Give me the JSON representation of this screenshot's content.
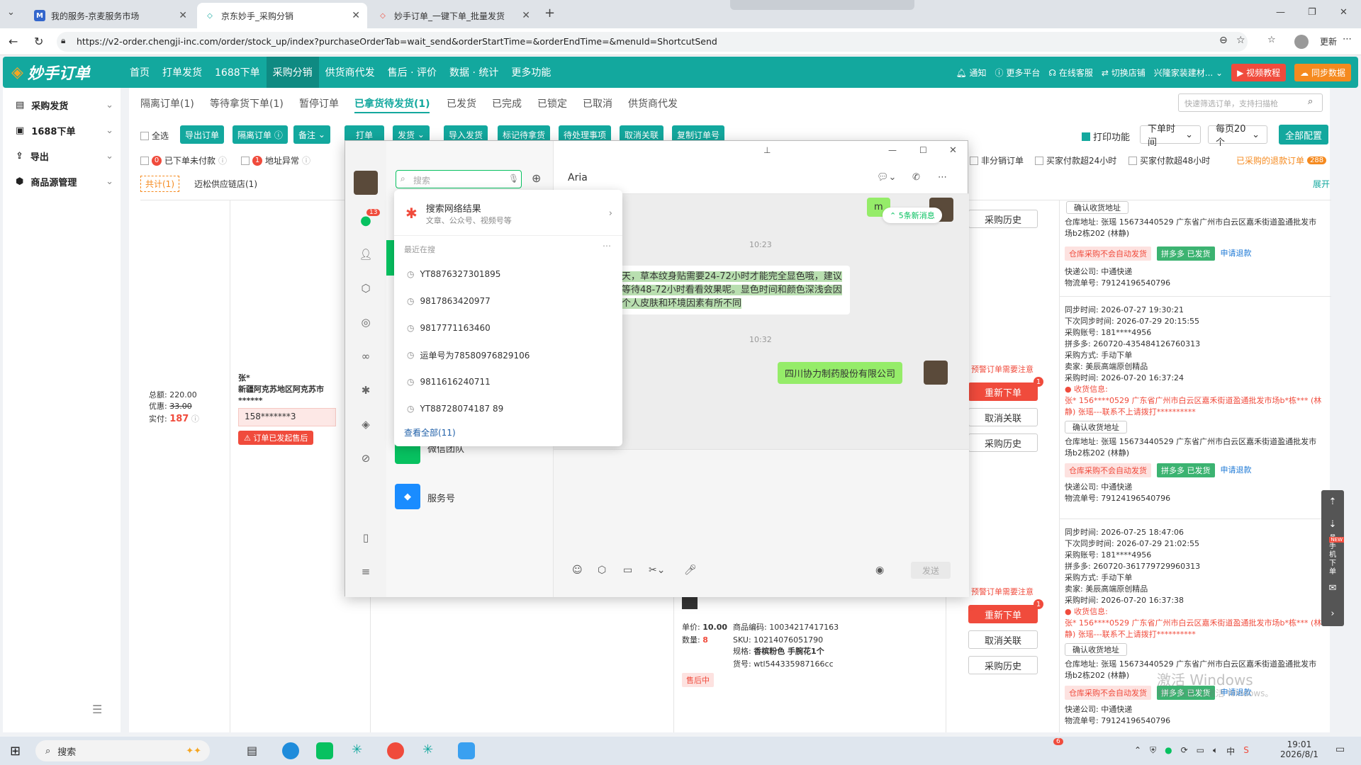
{
  "browser": {
    "tabs": [
      {
        "title": "我的服务-京麦服务市场",
        "icon": "M"
      },
      {
        "title": "京东妙手_采购分销",
        "icon": "◇"
      },
      {
        "title": "妙手订单_一键下单_批量发货",
        "icon": "◇"
      }
    ],
    "new_tab": "+",
    "url": "https://v2-order.chengji-inc.com/order/stock_up/index?purchaseOrderTab=wait_send&orderStartTime=&orderEndTime=&menuId=ShortcutSend",
    "update_label": "更新"
  },
  "app": {
    "logo": "妙手订单",
    "nav": [
      "首页",
      "打单发货",
      "1688下单",
      "采购分销",
      "供货商代发",
      "售后 · 评价",
      "数据 · 统计",
      "更多功能"
    ],
    "right_nav": [
      "通知",
      "更多平台",
      "在线客服",
      "切换店铺",
      "兴隆家装建材..."
    ],
    "video_btn": "视频教程",
    "sync_btn": "同步数据"
  },
  "sidebar": [
    {
      "label": "采购发货",
      "icon": "▤"
    },
    {
      "label": "1688下单",
      "icon": "▣"
    },
    {
      "label": "导出",
      "icon": "⇪"
    },
    {
      "label": "商品源管理",
      "icon": "⬢"
    }
  ],
  "subtabs": [
    "隔离订单(1)",
    "等待拿货下单(1)",
    "暂停订单",
    "已拿货待发货(1)",
    "已发货",
    "已完成",
    "已锁定",
    "已取消",
    "供货商代发"
  ],
  "search_placeholder": "快速筛选订单，支持扫描枪",
  "toolbar": {
    "select_all": "全选",
    "buttons": [
      "导出订单",
      "隔离订单 ⓘ",
      "备注",
      "打单",
      "发货",
      "导入发货",
      "标记待拿货",
      "待处理事项",
      "取消关联",
      "复制订单号"
    ],
    "print_func": "打印功能",
    "order_time": "下单时间",
    "per_page": "每页20个",
    "all_config": "全部配置"
  },
  "filters": {
    "unpaid": "已下单未付款",
    "unpaid_count": "0",
    "addr_abnormal": "地址异常",
    "addr_count": "1",
    "nondist": "非分销订单",
    "pay24": "买家付款超24小时",
    "pay48": "买家付款超48小时",
    "refund": "已采购的退款订单",
    "refund_count": "288"
  },
  "store": {
    "total": "共计(1)",
    "name": "迈松供应链店(1)",
    "expand": "展开"
  },
  "order": {
    "amount_label": "总额:",
    "amount": "220.00",
    "discount_label": "优惠:",
    "discount": "33.00",
    "paid_label": "实付:",
    "paid": "187",
    "buyer": "张*",
    "region": "新疆阿克苏地区阿克苏市",
    "masked": "******",
    "phone": "158*******3",
    "aftersale": "订单已发起售后",
    "price_label": "单价:",
    "price": "10.00",
    "qty_label": "数量:",
    "qty": "8",
    "code": "商品编码: 10034217417163",
    "sku": "SKU: 10214076051790",
    "spec_label": "规格:",
    "spec": "香槟粉色 手腕花1个",
    "goods_no": "货号: wtl544335987166cc",
    "status": "售后中"
  },
  "actions": {
    "history": "采购历史",
    "reorder": "重新下单",
    "cancel": "取消关联",
    "warn": "预警订单需要注意",
    "badge": "1"
  },
  "details": [
    {
      "sync": "同步时间: 2026-07-27 19:30:21",
      "next": "下次同步时间: 2026-07-29 20:15:55",
      "acct": "采购账号: 181****4956",
      "pdd": "拼多多: 260720-435484126760313",
      "method": "采购方式: 手动下单",
      "seller": "卖家: 美辰高端原创精品",
      "ptime": "采购时间: 2026-07-20 16:37:24"
    },
    {
      "sync": "同步时间: 2026-07-25 18:47:06",
      "next": "下次同步时间: 2026-07-29 21:02:55",
      "acct": "采购账号: 181****4956",
      "pdd": "拼多多: 260720-361779729960313",
      "method": "采购方式: 手动下单",
      "seller": "卖家: 美辰高端原创精品",
      "ptime": "采购时间: 2026-07-20 16:37:38"
    }
  ],
  "detail_common": {
    "confirm": "确认收货地址",
    "addr": "仓库地址: 张瑶 15673440529 广东省广州市白云区嘉禾街道盈通批发市场b2栋202 (林静)",
    "no_auto": "仓库采购不会自动发货",
    "pdd_sent": "拼多多 已发货",
    "refund": "申请退款",
    "courier": "快递公司: 中通快递",
    "tracking": "物流单号: 79124196540796",
    "recv": "收货信息:",
    "recv_addr": "张* 156****0529 广东省广州市白云区嘉禾街道盈通批发市场b*栋*** (林静) 张瑶---联系不上请拨打**********"
  },
  "chat": {
    "contact": "Aria",
    "search_placeholder": "搜索",
    "unread": "13",
    "new_msgs": "5条新消息",
    "time1": "10:23",
    "time2": "10:32",
    "msg_in": "天，草本纹身贴需要24-72小时才能完全显色哦，建议等待48-72小时看看效果呢。显色时间和颜色深浅会因个人皮肤和环境因素有所不同",
    "msg_out": "四川协力制药股份有限公司",
    "msg_top": "m",
    "send": "发送",
    "service": "服务号",
    "partial": "微信团队"
  },
  "dropdown": {
    "web_title": "搜索网络结果",
    "web_sub": "文章、公众号、视频号等",
    "recent": "最近在搜",
    "items": [
      "YT8876327301895",
      "9817863420977",
      "9817771163460",
      "运单号为78580976829106",
      "9811616240711",
      "YT88728074187 89"
    ],
    "view_all": "查看全部(11)"
  },
  "watermark": {
    "l1": "激活 Windows",
    "l2": "转到\"设置\"以激活 Windows。"
  },
  "taskbar": {
    "search": "搜索",
    "time": "19:01",
    "date": "2026/8/1",
    "ime": "中",
    "badge": "6"
  },
  "floatbar": {
    "phone": "手机下单",
    "new": "NEW"
  },
  "colors": {
    "accent": "#13a89e",
    "red": "#f04b3c",
    "green": "#3cb371",
    "chat_green": "#95ec69"
  }
}
